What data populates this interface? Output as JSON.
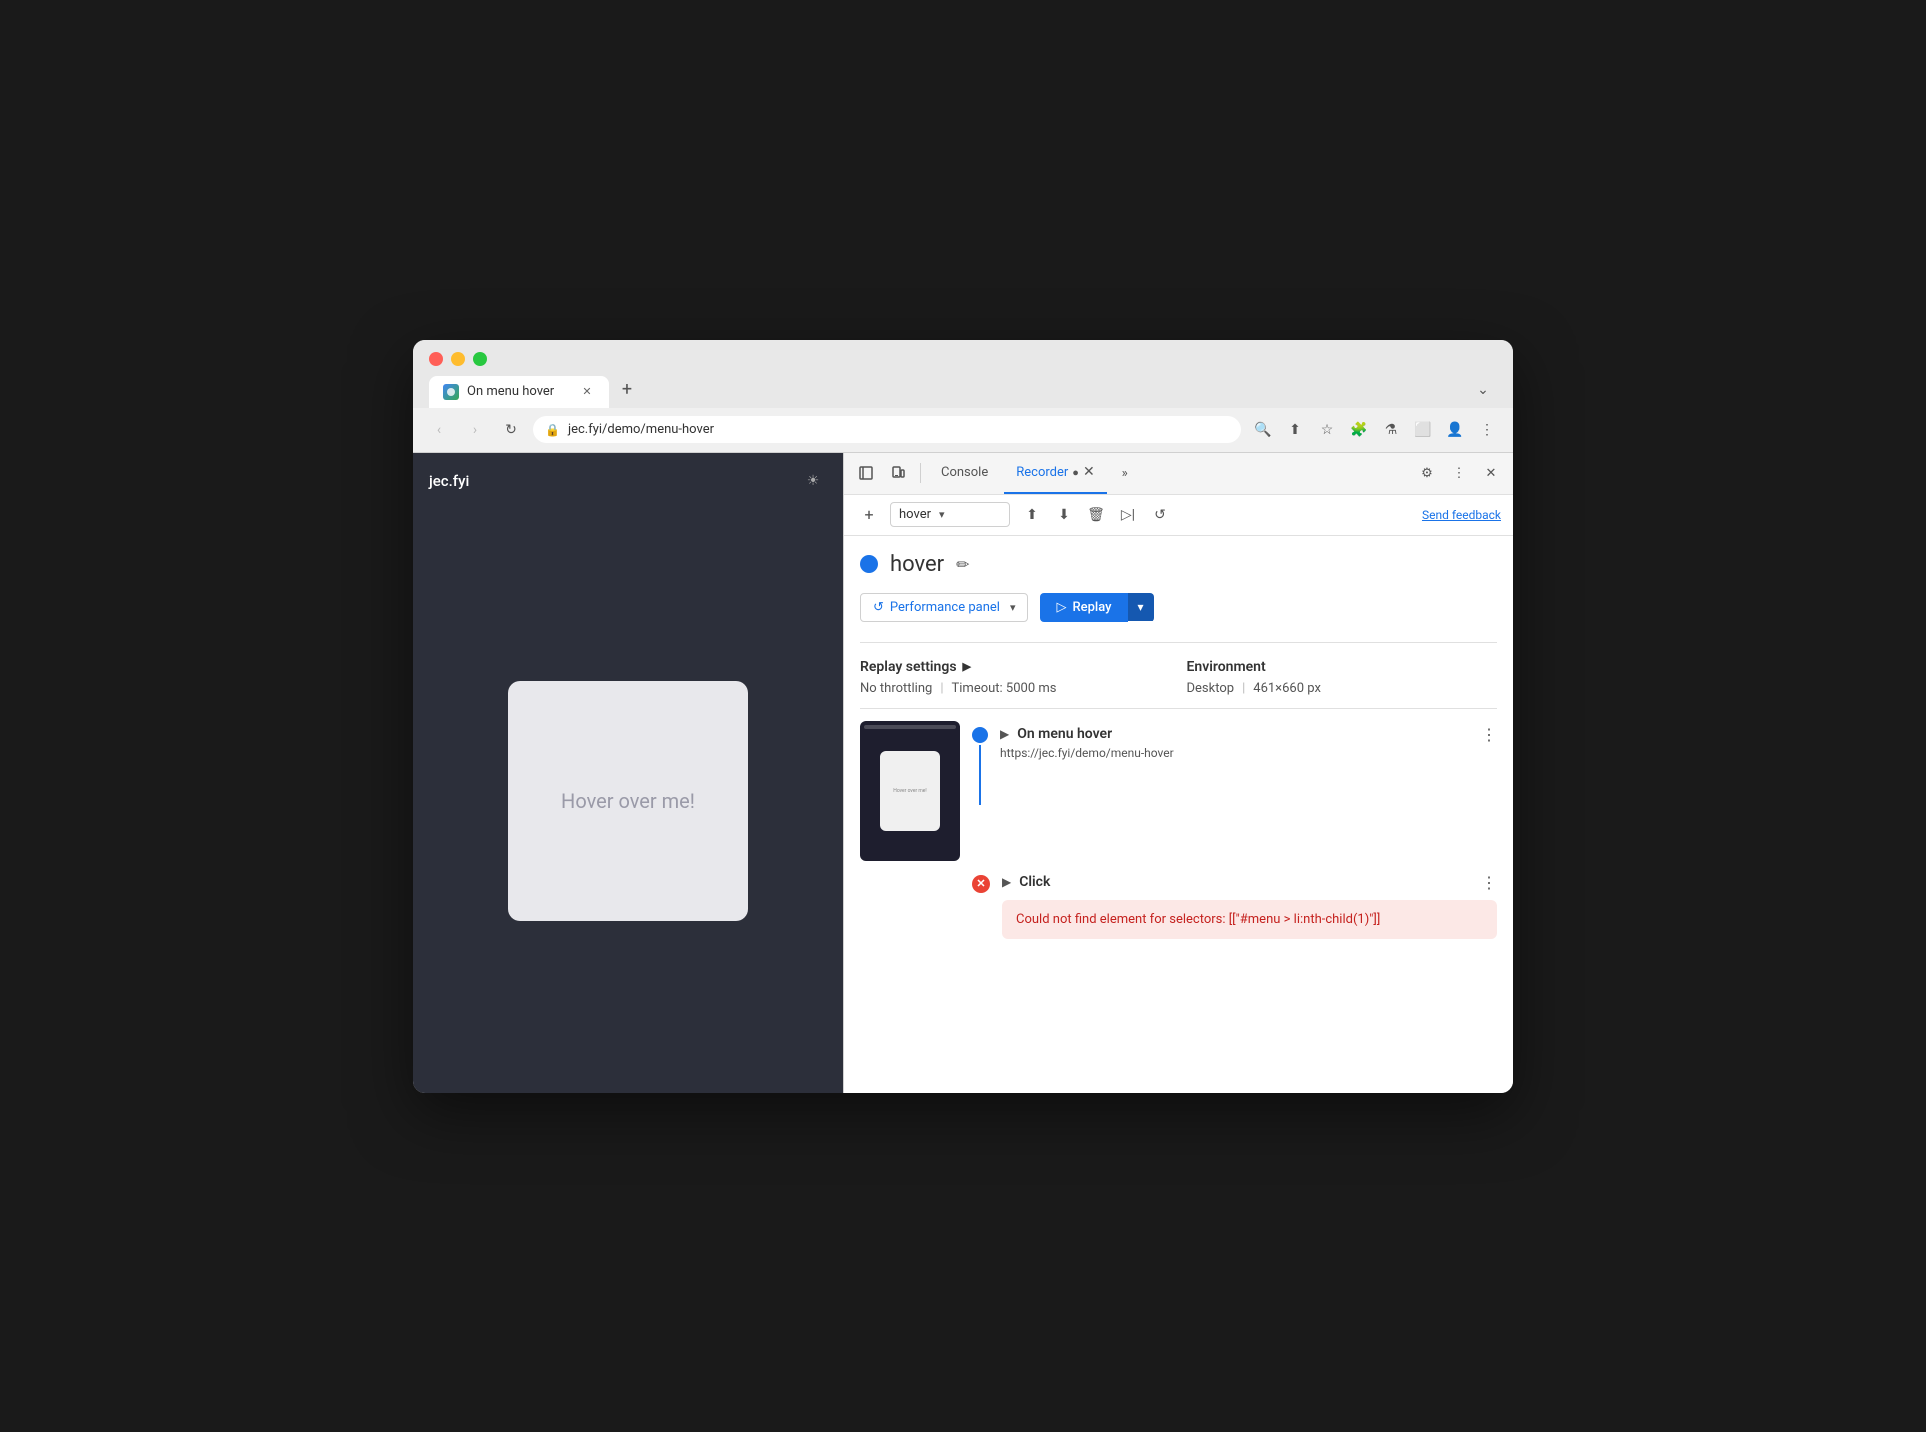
{
  "browser": {
    "tab_title": "On menu hover",
    "url": "jec.fyi/demo/menu-hover",
    "new_tab_label": "+",
    "expand_label": "⌄"
  },
  "nav": {
    "back_label": "‹",
    "forward_label": "›",
    "refresh_label": "↻",
    "lock_icon": "🔒"
  },
  "address_actions": {
    "search_icon": "🔍",
    "share_icon": "⬆",
    "bookmark_icon": "☆",
    "extension_icon": "🧩",
    "experiment_icon": "⚗",
    "sidebar_icon": "⬜",
    "account_icon": "👤",
    "menu_icon": "⋮"
  },
  "page": {
    "logo": "jec.fyi",
    "sun_icon": "☀",
    "hover_text": "Hover over me!"
  },
  "devtools": {
    "tabs": [
      {
        "label": "Console",
        "active": false
      },
      {
        "label": "Recorder",
        "active": true
      }
    ],
    "more_tabs_label": "»",
    "settings_icon": "⚙",
    "more_icon": "⋮",
    "close_icon": "✕",
    "inspect_icon": "⬜",
    "device_icon": "⬜",
    "rec_icon": "●"
  },
  "toolbar": {
    "add_label": "+",
    "recording_name": "hover",
    "chevron_down": "▾",
    "export_label": "⬆",
    "import_label": "⬇",
    "delete_label": "🗑",
    "play_slow_label": "▷|",
    "replay_icon": "↺",
    "send_feedback": "Send feedback"
  },
  "recording": {
    "indicator_color": "#1a73e8",
    "name": "hover",
    "edit_icon": "✏"
  },
  "replay_section": {
    "perf_panel_icon": "↺",
    "perf_panel_label": "Performance panel",
    "perf_chevron": "▾",
    "replay_icon": "▷",
    "replay_label": "Replay",
    "replay_chevron": "▾"
  },
  "settings": {
    "title": "Replay settings",
    "arrow": "▶",
    "throttling_label": "No throttling",
    "timeout_label": "Timeout: 5000 ms",
    "env_title": "Environment",
    "desktop_label": "Desktop",
    "resolution_label": "461×660 px"
  },
  "steps": {
    "step1": {
      "name": "On menu hover",
      "url": "https://jec.fyi/demo/menu-hover",
      "expand_icon": "▶",
      "more_icon": "⋮"
    },
    "step2": {
      "name": "Click",
      "expand_icon": "▶",
      "more_icon": "⋮",
      "error": "Could not find element for selectors: [[\"#menu > li:nth-child(1)\"]]"
    }
  }
}
